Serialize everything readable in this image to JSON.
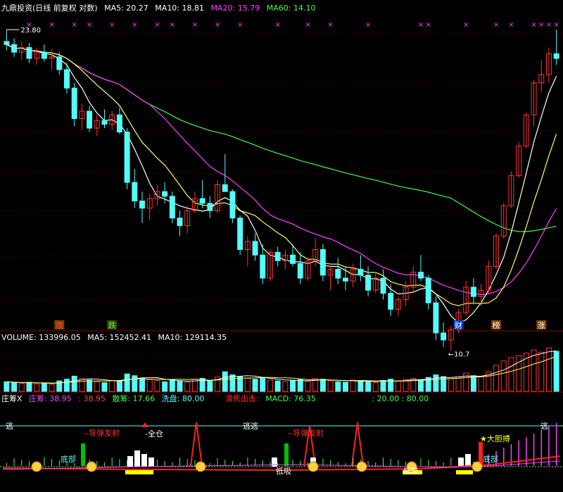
{
  "colors": {
    "bg": "#000000",
    "up": "#ff3232",
    "down": "#54fcfc",
    "ma5": "#ffffff",
    "ma10": "#ffff60",
    "ma20": "#ff40ff",
    "ma60": "#40ff40",
    "grid": "#800000",
    "white": "#ffffff"
  },
  "price_panel": {
    "title": "九鼎投资(日线 前复权 对数)",
    "ma_labels": [
      {
        "text": "MA5: 20.27",
        "color": "#ffffff"
      },
      {
        "text": "MA10: 18.81",
        "color": "#ffffff"
      },
      {
        "text": "MA20: 15.79",
        "color": "#ff40ff"
      },
      {
        "text": "MA60: 14.10",
        "color": "#40ff40"
      }
    ],
    "high_label": "23.80",
    "low_label": "10.7",
    "tags": [
      {
        "text": "增",
        "color": "#ff4040",
        "bg": "#804000"
      },
      {
        "text": "跌",
        "color": "#40ff40",
        "bg": "#404000"
      },
      {
        "text": "财",
        "color": "#ffffff",
        "bg": "#0040c0"
      },
      {
        "text": "榜",
        "color": "#ffffff",
        "bg": "#804000"
      },
      {
        "text": "涨",
        "color": "#ffffff",
        "bg": "#804000"
      }
    ]
  },
  "volume_panel": {
    "labels": [
      {
        "text": "VOLUME: 133996.05",
        "color": "#ffffff"
      },
      {
        "text": "MA5: 152452.41",
        "color": "#ffffff"
      },
      {
        "text": "MA10: 129114.35",
        "color": "#ffffff"
      }
    ]
  },
  "indicator_panel": {
    "labels": [
      {
        "text": "庄筹X",
        "color": "#ffffff"
      },
      {
        "text": "庄筹: 38.95",
        "color": "#ff40ff"
      },
      {
        "text": ": 38.95",
        "color": "#ff4040"
      },
      {
        "text": "散筹: 17.66",
        "color": "#40ff40"
      },
      {
        "text": "洗盘: 80.00",
        "color": "#54fcfc"
      }
    ],
    "labels_right": [
      {
        "text": "滑熊出击:",
        "color": "#ff3030"
      },
      {
        "text": "MACD: 76.35",
        "color": "#40ff40"
      },
      {
        "text": ": 20.00 : 80.00",
        "color": "#40ff40"
      }
    ],
    "annotations": [
      {
        "text": "逃",
        "color": "#ffffff"
      },
      {
        "text": "逃逃",
        "color": "#ffffff"
      },
      {
        "text": "逃",
        "color": "#ffffff"
      },
      {
        "text": "--导弹发射",
        "color": "#ff3030"
      },
      {
        "text": "--导弹发射",
        "color": "#ff3030"
      },
      {
        "text": "-全仓",
        "color": "#ffffff"
      },
      {
        "text": "★大胆搏",
        "color": "#ffff00"
      },
      {
        "text": "底部",
        "color": "#54fcfc"
      },
      {
        "text": "底部",
        "color": "#54fcfc"
      },
      {
        "text": "抵吸",
        "color": "#ffffff"
      },
      {
        "text": "抵吸",
        "color": "#ffffff"
      }
    ]
  },
  "chart_data": {
    "type": "candlestick",
    "scale": "log",
    "ylim": [
      10.0,
      25.0
    ],
    "ohlc": [
      [
        23.0,
        23.8,
        22.4,
        22.8
      ],
      [
        22.8,
        23.2,
        22.0,
        22.3
      ],
      [
        22.3,
        23.0,
        21.8,
        22.6
      ],
      [
        22.6,
        22.9,
        21.6,
        21.9
      ],
      [
        21.9,
        22.6,
        21.5,
        22.3
      ],
      [
        22.3,
        22.8,
        21.7,
        21.9
      ],
      [
        21.9,
        22.5,
        21.2,
        22.0
      ],
      [
        22.0,
        22.3,
        20.9,
        21.2
      ],
      [
        21.2,
        21.6,
        19.8,
        20.1
      ],
      [
        20.1,
        20.4,
        18.0,
        18.4
      ],
      [
        18.4,
        19.2,
        17.8,
        18.8
      ],
      [
        18.8,
        19.1,
        17.7,
        17.9
      ],
      [
        17.9,
        18.6,
        17.5,
        18.3
      ],
      [
        18.3,
        18.9,
        17.9,
        18.1
      ],
      [
        18.1,
        18.8,
        17.8,
        18.6
      ],
      [
        18.6,
        19.0,
        17.6,
        17.7
      ],
      [
        17.7,
        17.9,
        15.0,
        15.3
      ],
      [
        15.3,
        15.9,
        14.2,
        14.5
      ],
      [
        14.5,
        14.9,
        13.6,
        14.2
      ],
      [
        14.2,
        14.8,
        13.7,
        14.6
      ],
      [
        14.6,
        15.2,
        14.3,
        14.9
      ],
      [
        14.9,
        15.3,
        14.4,
        14.7
      ],
      [
        14.7,
        14.9,
        13.6,
        13.8
      ],
      [
        13.8,
        14.1,
        13.1,
        13.5
      ],
      [
        13.5,
        14.3,
        13.2,
        14.1
      ],
      [
        14.1,
        14.9,
        14.0,
        14.6
      ],
      [
        14.6,
        15.4,
        14.2,
        14.4
      ],
      [
        14.4,
        14.7,
        13.8,
        14.1
      ],
      [
        14.1,
        15.4,
        14.0,
        15.2
      ],
      [
        15.2,
        16.6,
        14.9,
        14.9
      ],
      [
        14.9,
        15.0,
        13.6,
        13.8
      ],
      [
        13.8,
        13.9,
        12.4,
        12.6
      ],
      [
        12.6,
        13.1,
        12.0,
        12.9
      ],
      [
        12.9,
        13.2,
        12.2,
        12.4
      ],
      [
        12.4,
        12.8,
        11.4,
        11.6
      ],
      [
        11.6,
        12.6,
        11.5,
        12.5
      ],
      [
        12.5,
        12.7,
        12.0,
        12.2
      ],
      [
        12.2,
        12.6,
        11.9,
        12.4
      ],
      [
        12.4,
        12.8,
        12.0,
        12.1
      ],
      [
        12.1,
        12.5,
        11.4,
        11.6
      ],
      [
        11.6,
        12.3,
        11.5,
        12.2
      ],
      [
        12.2,
        13.0,
        12.0,
        12.6
      ],
      [
        12.6,
        12.8,
        11.5,
        11.7
      ],
      [
        11.7,
        12.0,
        11.2,
        11.9
      ],
      [
        11.9,
        12.3,
        11.4,
        11.6
      ],
      [
        11.6,
        12.0,
        11.2,
        11.5
      ],
      [
        11.5,
        12.1,
        11.3,
        11.9
      ],
      [
        11.9,
        12.4,
        11.5,
        11.7
      ],
      [
        11.7,
        12.0,
        11.0,
        11.2
      ],
      [
        11.2,
        11.8,
        11.1,
        11.6
      ],
      [
        11.6,
        11.9,
        10.9,
        11.1
      ],
      [
        11.1,
        11.4,
        10.4,
        10.6
      ],
      [
        10.6,
        11.0,
        10.4,
        10.9
      ],
      [
        10.9,
        11.5,
        10.7,
        11.3
      ],
      [
        11.3,
        12.0,
        11.1,
        11.8
      ],
      [
        11.8,
        12.4,
        11.5,
        11.6
      ],
      [
        11.6,
        11.7,
        10.6,
        10.8
      ],
      [
        10.8,
        11.0,
        9.7,
        9.9
      ],
      [
        9.9,
        10.2,
        9.5,
        9.7
      ],
      [
        9.7,
        10.1,
        9.4,
        10.0
      ],
      [
        10.0,
        10.6,
        9.9,
        10.5
      ],
      [
        10.5,
        11.5,
        10.4,
        11.3
      ],
      [
        11.3,
        11.6,
        10.8,
        11.0
      ],
      [
        11.0,
        11.4,
        10.7,
        11.2
      ],
      [
        11.2,
        12.2,
        11.1,
        12.0
      ],
      [
        12.0,
        13.2,
        11.9,
        13.1
      ],
      [
        13.1,
        14.4,
        13.0,
        14.3
      ],
      [
        14.3,
        15.8,
        14.2,
        15.6
      ],
      [
        15.6,
        17.2,
        15.5,
        17.0
      ],
      [
        17.0,
        18.7,
        16.9,
        18.6
      ],
      [
        18.6,
        20.6,
        18.0,
        20.4
      ],
      [
        20.4,
        21.8,
        19.9,
        20.9
      ],
      [
        20.9,
        22.6,
        20.4,
        22.2
      ],
      [
        22.2,
        23.8,
        21.5,
        21.9
      ]
    ],
    "volume": [
      22,
      20,
      18,
      21,
      17,
      19,
      16,
      24,
      28,
      35,
      30,
      26,
      22,
      20,
      25,
      24,
      40,
      36,
      30,
      27,
      25,
      22,
      26,
      23,
      21,
      28,
      30,
      24,
      33,
      45,
      38,
      34,
      30,
      28,
      32,
      26,
      24,
      22,
      25,
      27,
      23,
      30,
      28,
      24,
      22,
      21,
      26,
      24,
      22,
      20,
      25,
      28,
      24,
      27,
      30,
      26,
      32,
      38,
      34,
      29,
      33,
      42,
      36,
      34,
      45,
      60,
      70,
      78,
      82,
      88,
      95,
      90,
      100,
      92
    ],
    "vol_ylim": [
      0,
      110
    ]
  }
}
